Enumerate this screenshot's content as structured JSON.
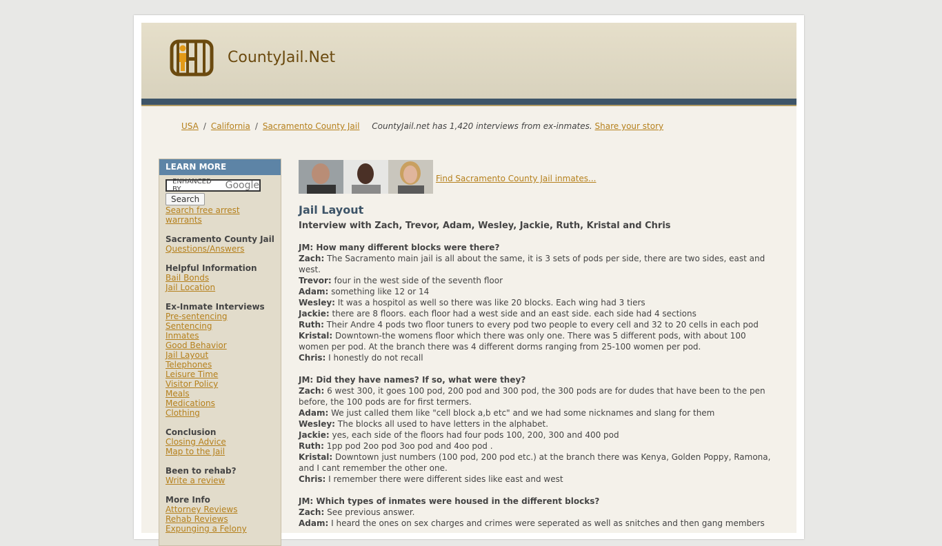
{
  "header": {
    "site_name": "CountyJail.Net",
    "logo_icon": "jail-cell-icon"
  },
  "breadcrumb": {
    "items": [
      "USA",
      "California",
      "Sacramento County Jail"
    ],
    "separator": "/",
    "note": "CountyJail.net has 1,420 interviews from ex-inmates.",
    "share_link": "Share your story"
  },
  "sidebar": {
    "header": "LEARN MORE",
    "google_badge_text": "ENHANCED BY",
    "google_word": "Google",
    "search_button": "Search",
    "warrants_link": "Search free arrest warrants",
    "groups": [
      {
        "title": "Sacramento County Jail",
        "links": [
          "Questions/Answers"
        ]
      },
      {
        "title": "Helpful Information",
        "links": [
          "Bail Bonds",
          "Jail Location"
        ]
      },
      {
        "title": "Ex-Inmate Interviews",
        "links": [
          "Pre-sentencing",
          "Sentencing",
          "Inmates",
          "Good Behavior",
          "Jail Layout",
          "Telephones",
          "Leisure Time",
          "Visitor Policy",
          "Meals",
          "Medications",
          "Clothing"
        ]
      },
      {
        "title": "Conclusion",
        "links": [
          "Closing Advice",
          "Map to the Jail"
        ]
      },
      {
        "title": "Been to rehab?",
        "links": [
          "Write a review"
        ]
      },
      {
        "title": "More Info",
        "links": [
          "Attorney Reviews",
          "Rehab Reviews",
          "Expunging a Felony"
        ]
      }
    ]
  },
  "main": {
    "find_link": "Find Sacramento County Jail inmates...",
    "title": "Jail Layout",
    "subtitle": "Interview with Zach, Trevor, Adam, Wesley, Jackie, Ruth, Kristal and Chris",
    "qa": [
      {
        "q": "JM: How many different blocks were there?",
        "answers": [
          [
            "Zach:",
            "The Sacramento main jail is all about the same, it is 3 sets of pods per side, there are two sides, east and west."
          ],
          [
            "Trevor:",
            "four in the west side of the seventh floor"
          ],
          [
            "Adam:",
            "something like 12 or 14"
          ],
          [
            "Wesley:",
            "It was a hospitol as well so there was like 20 blocks. Each wing had 3 tiers"
          ],
          [
            "Jackie:",
            "there are 8 floors. each floor had a west side and an east side. each side had 4 sections"
          ],
          [
            "Ruth:",
            "Their Andre 4 pods two floor tuners to every pod two people to every cell and 32 to 20 cells in each pod"
          ],
          [
            "Kristal:",
            "Downtown-the womens floor which there was only one. There was 5 different pods, with about 100 women per pod. At the branch there was 4 different dorms ranging from 25-100 women per pod."
          ],
          [
            "Chris:",
            "I honestly do not recall"
          ]
        ]
      },
      {
        "q": "JM: Did they have names? If so, what were they?",
        "answers": [
          [
            "Zach:",
            "6 west 300, it goes 100 pod, 200 pod and 300 pod, the 300 pods are for dudes that have been to the pen before, the 100 pods are for first termers."
          ],
          [
            "Adam:",
            "We just called them like \"cell block a,b etc\" and we had some nicknames and slang for them"
          ],
          [
            "Wesley:",
            "The blocks all used to have letters in the alphabet."
          ],
          [
            "Jackie:",
            "yes, each side of the floors had four pods 100, 200, 300 and 400 pod"
          ],
          [
            "Ruth:",
            "1pp pod 2oo pod 3oo pod and 4oo pod ."
          ],
          [
            "Kristal:",
            "Downtown just numbers (100 pod, 200 pod etc.) at the branch there was Kenya, Golden Poppy, Ramona, and I cant remember the other one."
          ],
          [
            "Chris:",
            "I remember there were different sides like east and west"
          ]
        ]
      },
      {
        "q": "JM: Which types of inmates were housed in the different blocks?",
        "answers": [
          [
            "Zach:",
            "See previous answer."
          ],
          [
            "Adam:",
            "I heard the ones on sex charges and crimes were seperated as well as snitches and then gang members"
          ]
        ]
      }
    ]
  }
}
